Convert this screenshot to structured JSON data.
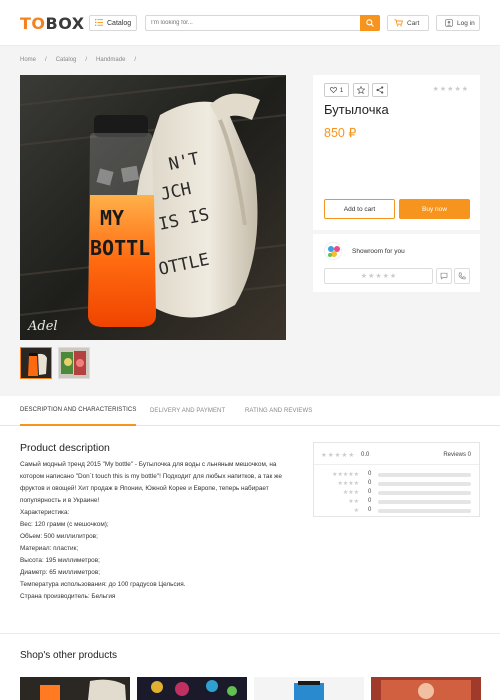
{
  "header": {
    "logo_to": "TO",
    "logo_box": "BOX",
    "catalog_label": "Catalog",
    "search_placeholder": "I'm looking for...",
    "cart_label": "Cart",
    "login_label": "Log in"
  },
  "breadcrumbs": [
    "Home",
    "Catalog",
    "Handmade"
  ],
  "breadcrumb_sep": "/",
  "product": {
    "likes": "1",
    "title": "Бутылочка",
    "price": "850 ₽",
    "add_to_cart": "Add to cart",
    "buy_now": "Buy now",
    "stars_filled": 0,
    "stars_total": 5
  },
  "shop": {
    "name": "Showroom for you"
  },
  "tabs": [
    {
      "label": "DESCRIPTION AND CHARACTERISTICS",
      "active": true
    },
    {
      "label": "DELIVERY AND PAYMENT",
      "active": false
    },
    {
      "label": "RATING AND REVIEWS",
      "active": false
    }
  ],
  "description": {
    "title": "Product description",
    "lines": [
      "Самый модный тренд 2015 \"My bottle\" - Бутылочка для воды с льняным мешочком, на котором написано \"Don`t touch this is my bottle\"! Подходит для любых напитков, а так же фруктов и овощей! Хит продаж в Японии, Южной Корее и Европе, теперь набирает популярность и в Украине!",
      "Характеристика:",
      "Вес: 120 грамм (с мешочком);",
      "Объем: 500 миллилитров;",
      "Материал: пластик;",
      "Высота: 195 миллиметров;",
      "Диаметр: 65 миллиметров;",
      "Температура использования: до 100 градусов Цельсия.",
      "Страна производитель: Бельгия"
    ]
  },
  "reviews": {
    "score": "0.0",
    "label": "Reviews 0",
    "rows": [
      {
        "stars": 5,
        "count": "0",
        "fill": 0
      },
      {
        "stars": 4,
        "count": "0",
        "fill": 0
      },
      {
        "stars": 3,
        "count": "0",
        "fill": 0
      },
      {
        "stars": 2,
        "count": "0",
        "fill": 0
      },
      {
        "stars": 1,
        "count": "0",
        "fill": 0
      }
    ]
  },
  "other_products_title": "Shop's other products",
  "colors": {
    "accent": "#f7941d",
    "logo_orange": "#f5821f",
    "logo_dark": "#3b3b3b"
  }
}
